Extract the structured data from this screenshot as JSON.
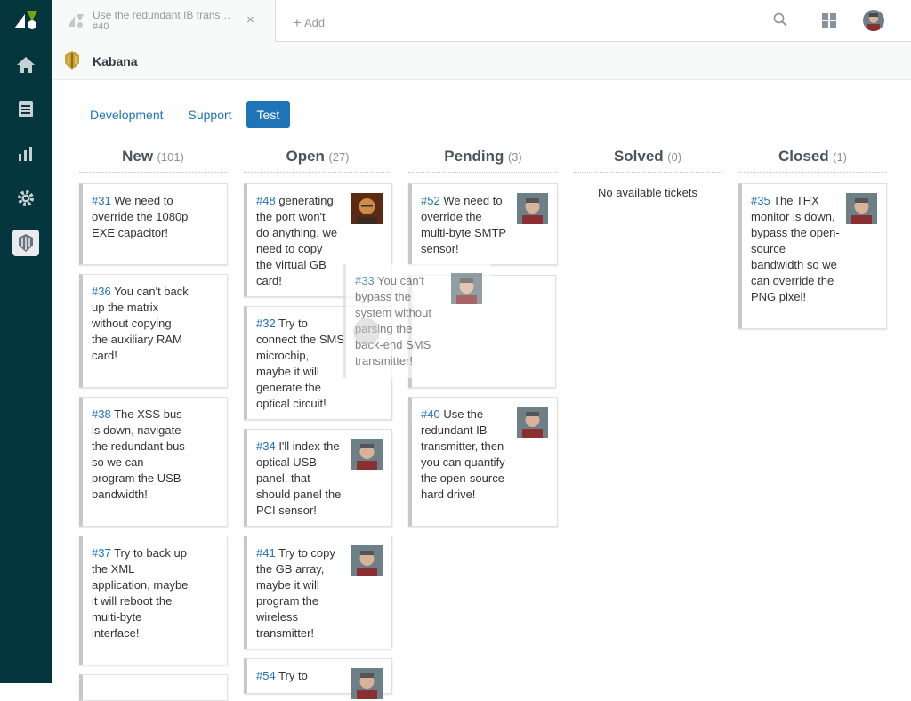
{
  "topbar": {
    "tab": {
      "title": "Use the redundant IB transmitter, then you can quantify the open-source hard drive!",
      "subtitle": "#40",
      "close": "×"
    },
    "add_label": "Add"
  },
  "app": {
    "name": "Kabana"
  },
  "filters": [
    {
      "label": "Development",
      "active": false
    },
    {
      "label": "Support",
      "active": false
    },
    {
      "label": "Test",
      "active": true
    }
  ],
  "columns": [
    {
      "name": "New",
      "count": "(101)"
    },
    {
      "name": "Open",
      "count": "(27)"
    },
    {
      "name": "Pending",
      "count": "(3)"
    },
    {
      "name": "Solved",
      "count": "(0)"
    },
    {
      "name": "Closed",
      "count": "(1)"
    }
  ],
  "empty_solved": "No available tickets",
  "cards": {
    "c31": {
      "num": "#31",
      "text": " We need to override the 1080p EXE capacitor!"
    },
    "c36": {
      "num": "#36",
      "text": " You can't back up the matrix without copying the auxiliary RAM card!"
    },
    "c38": {
      "num": "#38",
      "text": " The XSS bus is down, navigate the redundant bus so we can program the USB bandwidth!"
    },
    "c37": {
      "num": "#37",
      "text": " Try to back up the XML application, maybe it will reboot the multi-byte interface!"
    },
    "c48": {
      "num": "#48",
      "text": " generating the port won't do anything, we need to copy the virtual GB card!"
    },
    "c32": {
      "num": "#32",
      "text": " Try to connect the SMS microchip, maybe it will generate the optical circuit!"
    },
    "c34": {
      "num": "#34",
      "text": " I'll index the optical USB panel, that should panel the PCI sensor!"
    },
    "c41": {
      "num": "#41",
      "text": " Try to copy the GB array, maybe it will program the wireless transmitter!"
    },
    "c54": {
      "num": "#54",
      "text": " Try to"
    },
    "c52": {
      "num": "#52",
      "text": " We need to override the multi-byte SMTP sensor!"
    },
    "c40": {
      "num": "#40",
      "text": " Use the redundant IB transmitter, then you can quantify the open-source hard drive!"
    },
    "c35": {
      "num": "#35",
      "text": " The THX monitor is down, bypass the open-source bandwidth so we can override the PNG pixel!"
    },
    "c33": {
      "num": "#33",
      "text": " You can't bypass the system without parsing the back-end SMS transmitter!"
    }
  }
}
